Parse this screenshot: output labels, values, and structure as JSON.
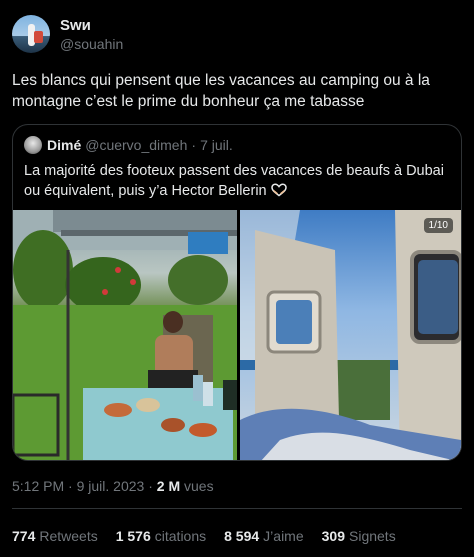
{
  "author": {
    "display_name": "Swи",
    "handle": "@souahin",
    "avatar_icon": "profile-avatar"
  },
  "tweet": {
    "text": "Les blancs qui pensent que les vacances au camping ou à la montagne c’est le prime du bonheur ça me tabasse"
  },
  "quote": {
    "display_name": "Dimé",
    "handle": "@cuervo_dimeh",
    "separator": "·",
    "date": "7 juil.",
    "text": "La majorité des footeux passent des vacances de beaufs à Dubai ou équivalent, puis y’a Hector Bellerin",
    "emoji_icon": "heart-hands-icon",
    "media_counter": "1/10"
  },
  "meta": {
    "time": "5:12 PM",
    "separator1": "·",
    "date": "9 juil. 2023",
    "separator2": "·",
    "views_count": "2 M",
    "views_label": "vues"
  },
  "stats": {
    "retweets_count": "774",
    "retweets_label": "Retweets",
    "quotes_count": "1 576",
    "quotes_label": "citations",
    "likes_count": "8 594",
    "likes_label": "J’aime",
    "bookmarks_count": "309",
    "bookmarks_label": "Signets"
  }
}
